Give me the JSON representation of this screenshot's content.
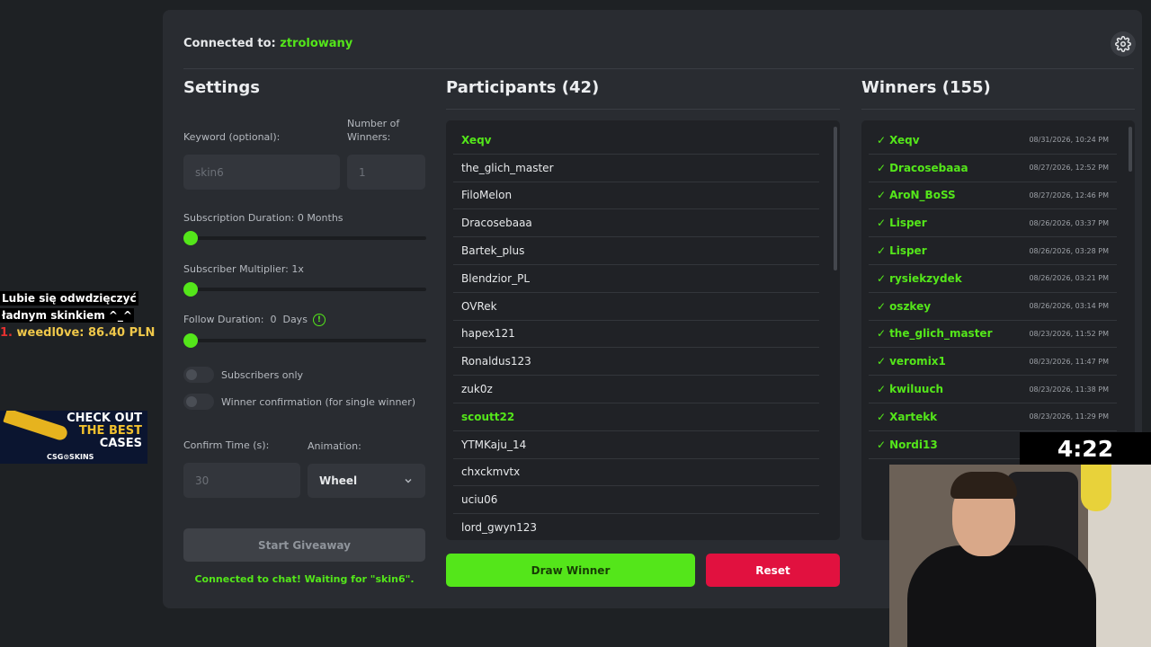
{
  "header": {
    "connected_label": "Connected to:",
    "channel": "ztrolowany"
  },
  "settings": {
    "title": "Settings",
    "keyword_label": "Keyword (optional):",
    "keyword_placeholder": "skin6",
    "winners_label_1": "Number of",
    "winners_label_2": "Winners:",
    "winners_placeholder": "1",
    "sub_duration_label": "Subscription Duration: 0 Months",
    "sub_duration_value": 0,
    "sub_multiplier_label": "Subscriber Multiplier: 1x",
    "sub_multiplier_value": 1,
    "follow_duration_label": "Follow Duration:  0  Days",
    "follow_duration_value": 0,
    "subscribers_only_label": "Subscribers only",
    "subscribers_only": false,
    "winner_confirmation_label": "Winner confirmation (for single winner)",
    "winner_confirmation": false,
    "confirm_time_label": "Confirm Time (s):",
    "confirm_time_placeholder": "30",
    "animation_label": "Animation:",
    "animation_value": "Wheel",
    "start_button": "Start Giveaway",
    "status_message": "Connected to chat! Waiting for \"skin6\"."
  },
  "participants": {
    "title": "Participants (42)",
    "items": [
      {
        "name": "Xeqv",
        "highlight": true
      },
      {
        "name": "the_glich_master",
        "highlight": false
      },
      {
        "name": "FiloMelon",
        "highlight": false
      },
      {
        "name": "Dracosebaaa",
        "highlight": false
      },
      {
        "name": "Bartek_plus",
        "highlight": false
      },
      {
        "name": "Blendzior_PL",
        "highlight": false
      },
      {
        "name": "OVRek",
        "highlight": false
      },
      {
        "name": "hapex121",
        "highlight": false
      },
      {
        "name": "Ronaldus123",
        "highlight": false
      },
      {
        "name": "zuk0z",
        "highlight": false
      },
      {
        "name": "scoutt22",
        "highlight": true
      },
      {
        "name": "YTMKaju_14",
        "highlight": false
      },
      {
        "name": "chxckmvtx",
        "highlight": false
      },
      {
        "name": "uciu06",
        "highlight": false
      },
      {
        "name": "lord_gwyn123",
        "highlight": false
      }
    ]
  },
  "winners": {
    "title": "Winners (155)",
    "check": "✓",
    "items": [
      {
        "name": "Xeqv",
        "date": "08/31/2026, 10:24 PM"
      },
      {
        "name": "Dracosebaaa",
        "date": "08/27/2026, 12:52 PM"
      },
      {
        "name": "AroN_BoSS",
        "date": "08/27/2026, 12:46 PM"
      },
      {
        "name": "Lisper",
        "date": "08/26/2026, 03:37 PM"
      },
      {
        "name": "Lisper",
        "date": "08/26/2026, 03:28 PM"
      },
      {
        "name": "rysiekzydek",
        "date": "08/26/2026, 03:21 PM"
      },
      {
        "name": "oszkey",
        "date": "08/26/2026, 03:14 PM"
      },
      {
        "name": "the_glich_master",
        "date": "08/23/2026, 11:52 PM"
      },
      {
        "name": "veromix1",
        "date": "08/23/2026, 11:47 PM"
      },
      {
        "name": "kwiluuch",
        "date": "08/23/2026, 11:38 PM"
      },
      {
        "name": "Xartekk",
        "date": "08/23/2026, 11:29 PM"
      },
      {
        "name": "Nordi13",
        "date": ""
      }
    ]
  },
  "actions": {
    "draw_button": "Draw Winner",
    "reset_button": "Reset"
  },
  "overlay": {
    "donation_line1": "Lubie się odwdzięczyć",
    "donation_line2": "ładnym skinkiem ^_^",
    "donation_rank": "1.",
    "donation_user": "weedl0ve: 86.40 PLN",
    "ad_line1": "CHECK OUT",
    "ad_line2": "THE BEST",
    "ad_line3": "CASES",
    "ad_brand": "CSG⊙SKINS",
    "timer": "4:22"
  },
  "colors": {
    "accent": "#54e61a",
    "danger": "#e1113f",
    "panel": "#292c31",
    "background": "#1e2124"
  }
}
